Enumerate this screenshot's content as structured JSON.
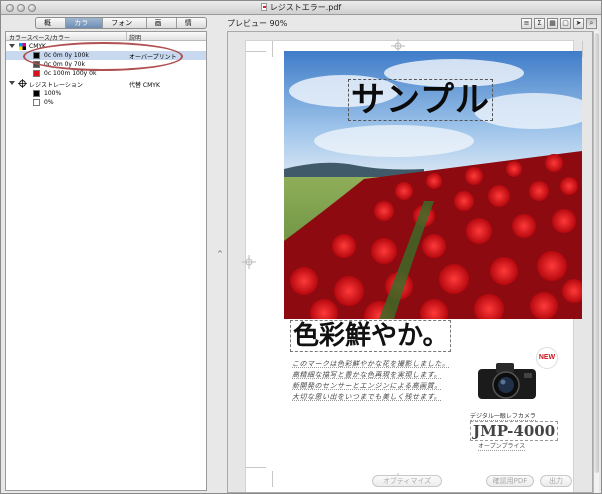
{
  "window": {
    "title": "レジストエラー.pdf"
  },
  "tabs": [
    {
      "label": "概要"
    },
    {
      "label": "カラー"
    },
    {
      "label": "フォント"
    },
    {
      "label": "画像"
    },
    {
      "label": "情報"
    }
  ],
  "active_tab": "カラー",
  "color_list": {
    "headers": {
      "colorspace": "カラースペース/カラー",
      "description": "説明"
    },
    "groups": [
      {
        "name": "CMYK",
        "items": [
          {
            "label": "0c 0m 0y 100k",
            "description": "オーバープリント",
            "swatch": "#000000",
            "selected": true
          },
          {
            "label": "0c 0m 0y 70k",
            "description": "",
            "swatch": "#4d4d4d",
            "selected": false
          },
          {
            "label": "0c 100m 100y 0k",
            "description": "",
            "swatch": "#d8141b",
            "selected": false
          }
        ]
      },
      {
        "name": "レジストレーション",
        "description": "代替 CMYK",
        "items": [
          {
            "label": "100%",
            "swatch": "#000000"
          },
          {
            "label": "0%",
            "swatch": "#ffffff"
          }
        ]
      }
    ]
  },
  "preview": {
    "label": "プレビュー 90%",
    "tools": [
      "stack-icon",
      "sigma-icon",
      "grid-icon",
      "page-icon",
      "arrow-icon",
      "zoom-icon"
    ],
    "headline": "サンプル",
    "subhead": "色彩鮮やか。",
    "body_lines": [
      "このマークは色彩鮮やかな花を撮影しました。",
      "高精細な描写と豊かな色再現を実現します。",
      "新開発のセンサーとエンジンによる高画質。",
      "大切な思い出をいつまでも美しく残せます。"
    ],
    "camera_badge": "NEW",
    "camera_small": "デジタル一眼レフカメラ",
    "camera_model": "JMP-4000",
    "camera_tag": "オープンプライス",
    "buttons": [
      {
        "label": "オブティマイズ"
      },
      {
        "label": "確認用PDF"
      },
      {
        "label": "出力"
      }
    ]
  },
  "colors": {
    "callout": "#b05050",
    "selection": "#c8d9ef",
    "flower_red": "#d8141b"
  }
}
